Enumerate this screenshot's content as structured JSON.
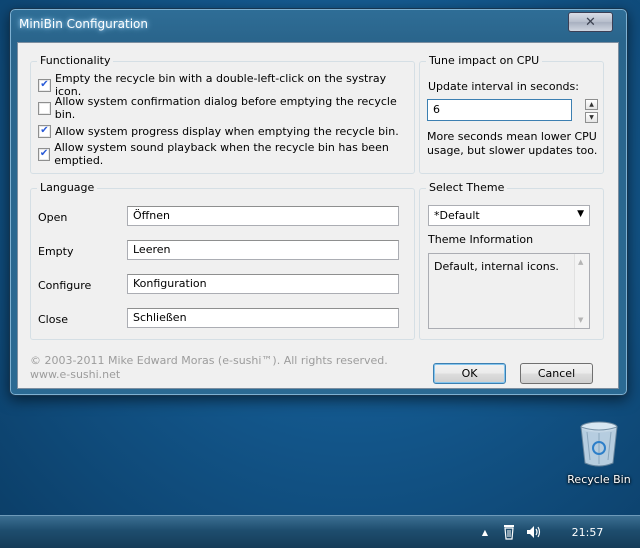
{
  "window": {
    "title": "MiniBin Configuration",
    "close_glyph": "✕"
  },
  "functionality": {
    "title": "Functionality",
    "options": [
      {
        "label": "Empty the recycle bin with a double-left-click on the systray icon.",
        "checked": true
      },
      {
        "label": "Allow system confirmation dialog before emptying the recycle bin.",
        "checked": false
      },
      {
        "label": "Allow system progress display when emptying the recycle bin.",
        "checked": true
      },
      {
        "label": "Allow system sound playback when the recycle bin has been emptied.",
        "checked": true
      }
    ]
  },
  "cpu": {
    "title": "Tune impact on CPU",
    "interval_label": "Update interval in seconds:",
    "interval_value": "6",
    "hint": "More seconds mean lower CPU usage, but slower updates too."
  },
  "language": {
    "title": "Language",
    "rows": [
      {
        "label": "Open",
        "value": "Öffnen"
      },
      {
        "label": "Empty",
        "value": "Leeren"
      },
      {
        "label": "Configure",
        "value": "Konfiguration"
      },
      {
        "label": "Close",
        "value": "Schließen"
      }
    ]
  },
  "theme": {
    "title": "Select Theme",
    "selected": "*Default",
    "info_label": "Theme Information",
    "info_text": "Default, internal icons."
  },
  "footer": {
    "copyright": "© 2003-2011 Mike Edward Moras (e-sushi™). All rights reserved.",
    "url": "www.e-sushi.net"
  },
  "buttons": {
    "ok": "OK",
    "cancel": "Cancel"
  },
  "desktop": {
    "recycle_bin_label": "Recycle Bin"
  },
  "taskbar": {
    "clock": "21:57"
  },
  "colors": {
    "desktop": "#13578c",
    "window_frame": "#2b6a93",
    "dialog_bg": "#f0f0f0",
    "checkbox_accent": "#2a5bd7"
  }
}
